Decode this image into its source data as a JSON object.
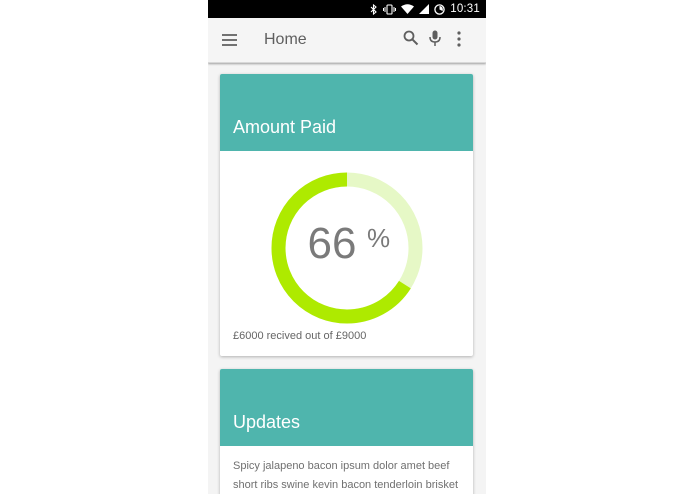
{
  "status_bar": {
    "time": "10:31",
    "icons": [
      "bluetooth-icon",
      "vibrate-icon",
      "wifi-icon",
      "signal-icon",
      "battery-icon"
    ]
  },
  "app_bar": {
    "title": "Home",
    "icons": [
      "menu-icon",
      "search-icon",
      "mic-icon",
      "more-vert-icon"
    ]
  },
  "amount_card": {
    "title": "Amount Paid",
    "percent_value": "66",
    "percent_sign": "%",
    "progress_fraction": 0.66,
    "caption": "£6000 recived out of £9000"
  },
  "updates_card": {
    "title": "Updates",
    "body": "Spicy jalapeno bacon ipsum dolor amet beef short ribs swine kevin bacon tenderloin brisket"
  },
  "colors": {
    "header_teal": "#4fb5ad",
    "progress_fill": "#aeea00",
    "progress_track": "#e6f8c6",
    "status_bar": "#000000"
  }
}
